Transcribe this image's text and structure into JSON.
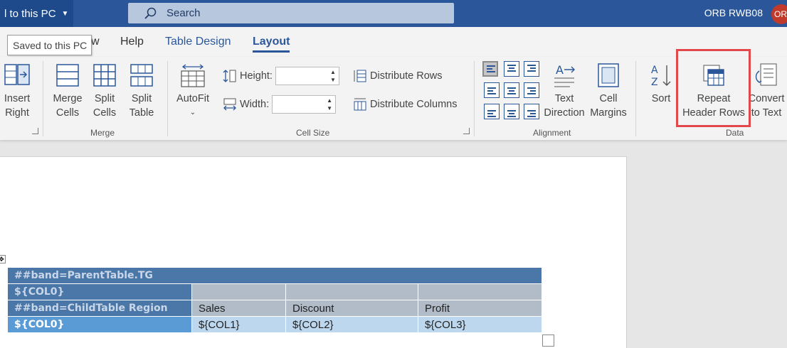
{
  "titlebar": {
    "save_location": "l to this PC",
    "search_placeholder": "Search",
    "user_name": "ORB RWB08",
    "avatar_initials": "OR"
  },
  "tooltip": "Saved to this PC",
  "tabs": {
    "view": "w",
    "help": "Help",
    "table_design": "Table Design",
    "layout": "Layout"
  },
  "ribbon": {
    "rows_columns": {
      "insert_right_1": "Insert",
      "insert_right_2": "Right"
    },
    "merge": {
      "label": "Merge",
      "merge_cells_1": "Merge",
      "merge_cells_2": "Cells",
      "split_cells_1": "Split",
      "split_cells_2": "Cells",
      "split_table_1": "Split",
      "split_table_2": "Table"
    },
    "cell_size": {
      "label": "Cell Size",
      "autofit": "AutoFit",
      "height_label": "Height:",
      "width_label": "Width:",
      "distribute_rows": "Distribute Rows",
      "distribute_columns": "Distribute Columns"
    },
    "alignment": {
      "label": "Alignment",
      "text_direction_1": "Text",
      "text_direction_2": "Direction",
      "cell_margins_1": "Cell",
      "cell_margins_2": "Margins"
    },
    "data": {
      "label": "Data",
      "sort": "Sort",
      "repeat_header_1": "Repeat",
      "repeat_header_2": "Header Rows",
      "convert_1": "Convert",
      "convert_2": "to Text"
    }
  },
  "table": {
    "row_band": "##band=ParentTable.TG",
    "row_col0": "${COL0}",
    "row_child": "##band=ChildTable Region",
    "headers": [
      "Sales",
      "Discount",
      "Profit"
    ],
    "data_first": "${COL0}",
    "data_cells": [
      "${COL1}",
      "${COL2}",
      "${COL3}"
    ]
  },
  "colors": {
    "titlebar": "#2b579a",
    "band_header": "#4a77a8",
    "data_header": "#5b9bd5",
    "data_cell": "#bdd7ee",
    "highlight": "#e0484b"
  }
}
